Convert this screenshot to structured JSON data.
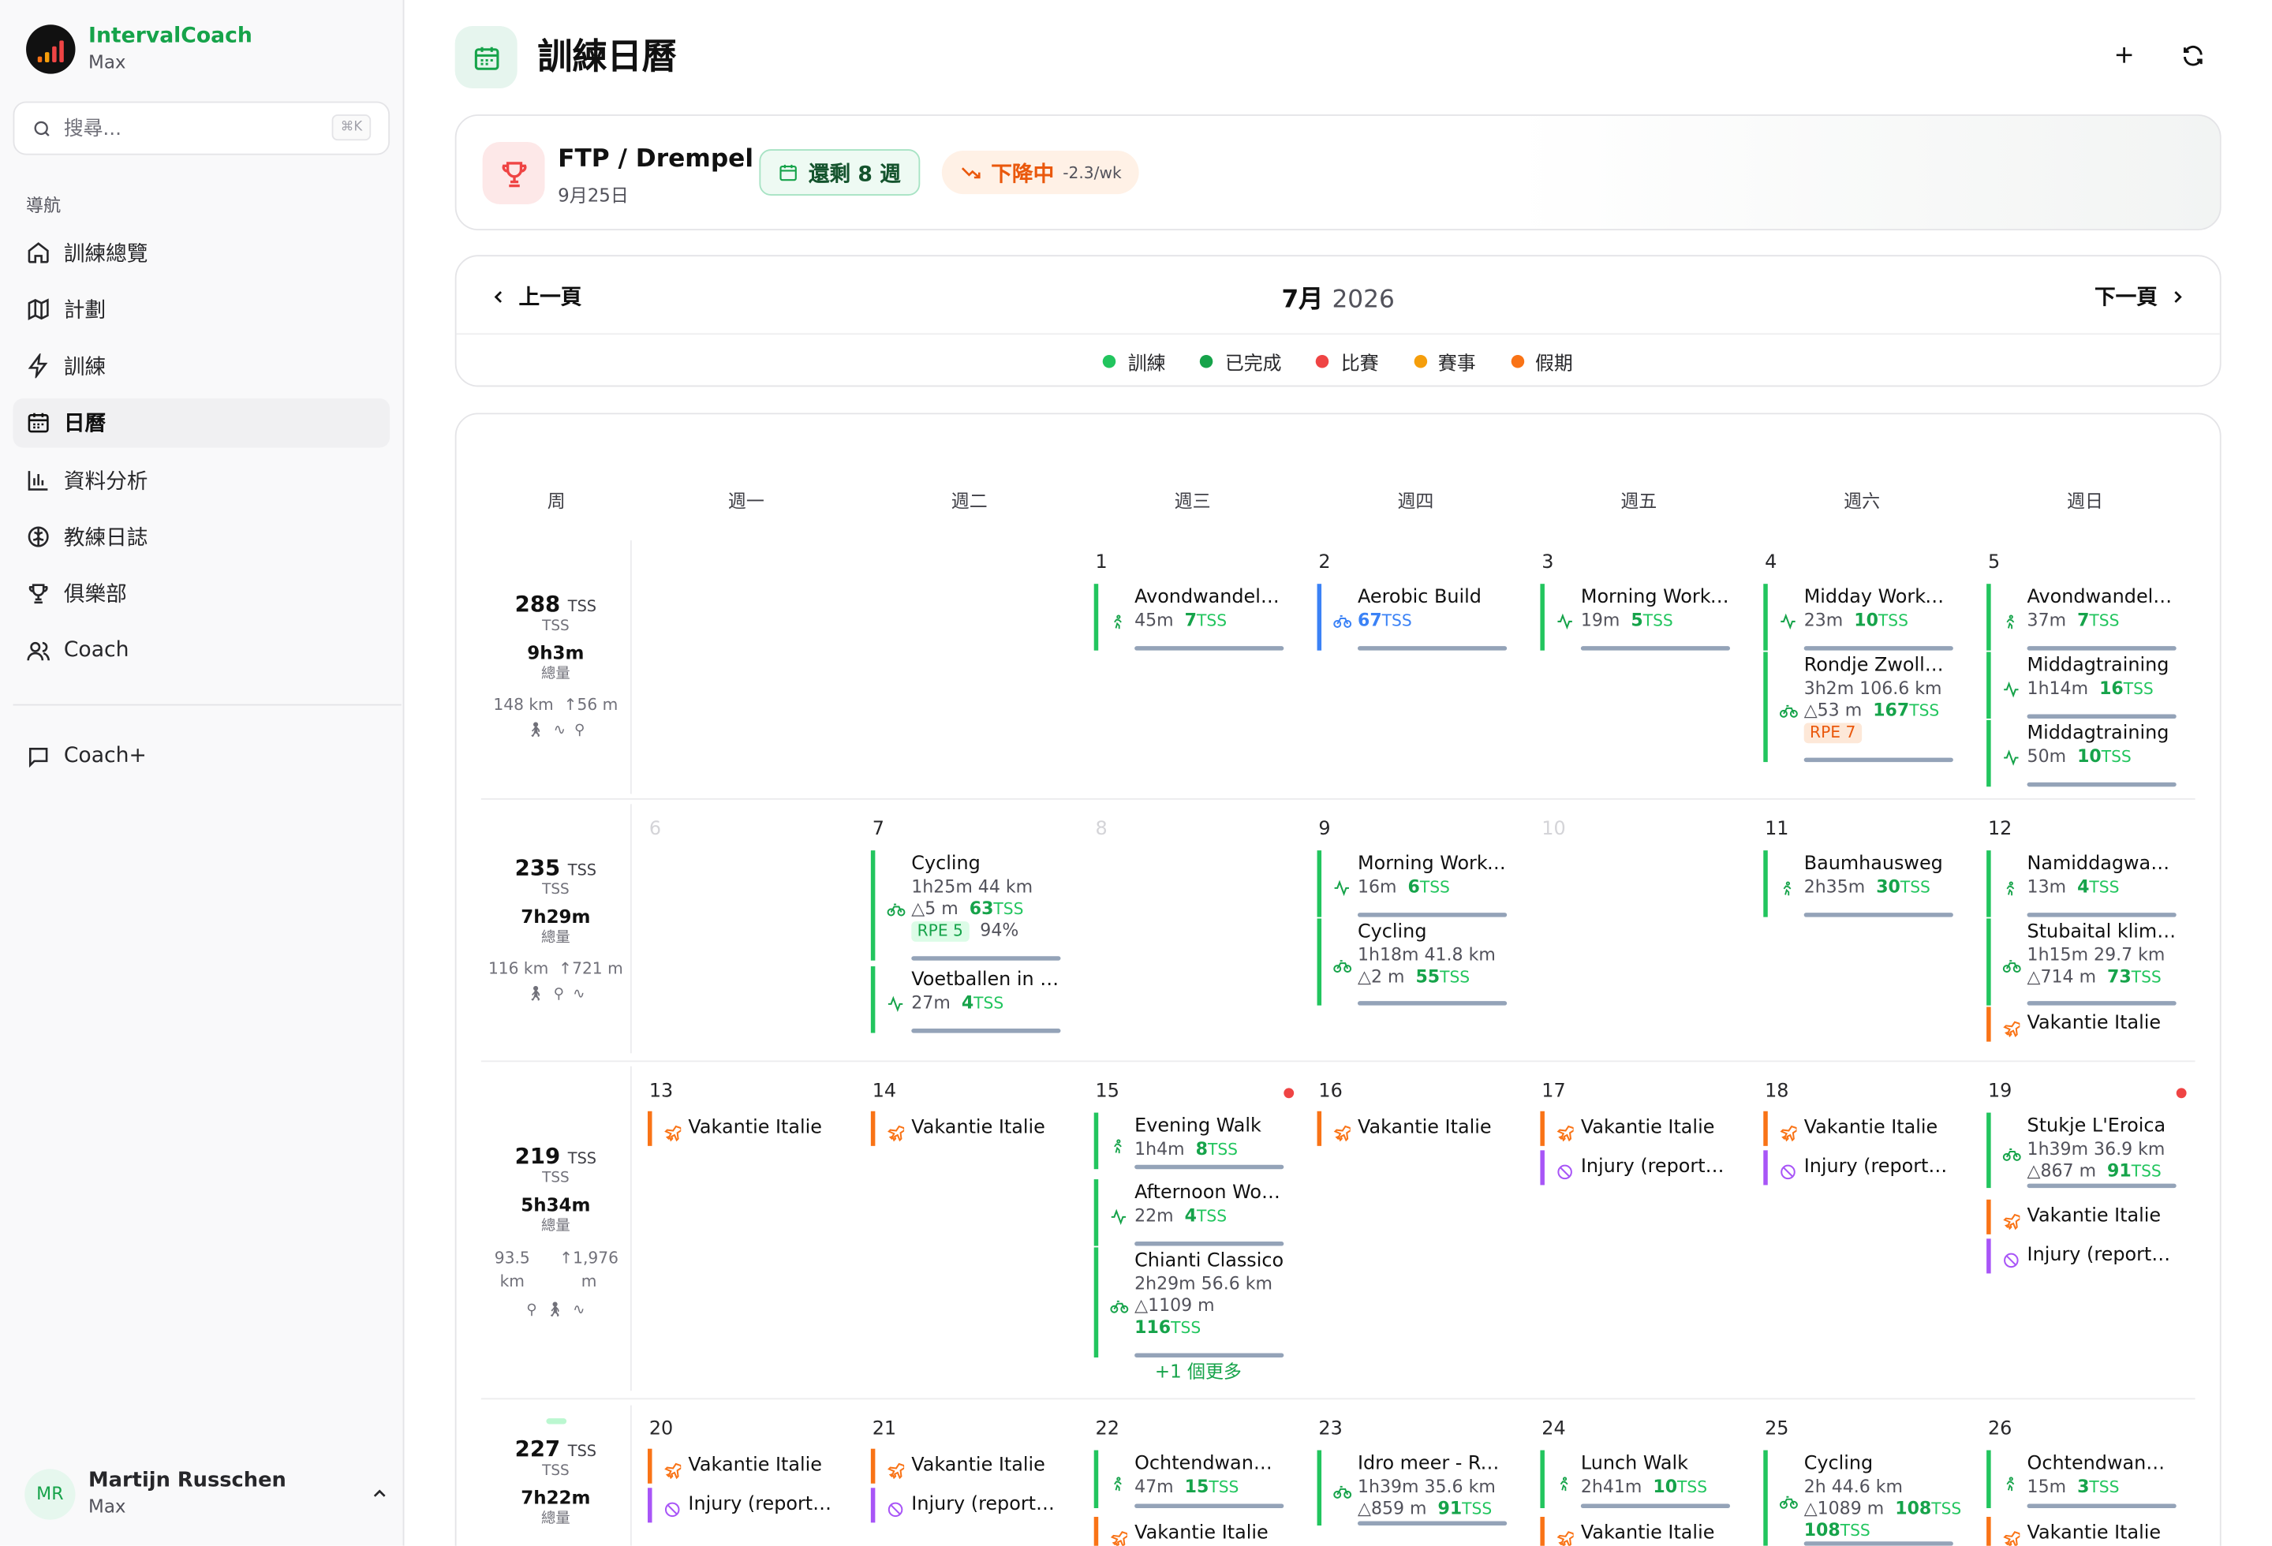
{
  "app": {
    "name": "IntervalCoach",
    "user": "Max"
  },
  "search": {
    "placeholder": "搜尋...",
    "shortcut": "⌘K"
  },
  "nav": {
    "heading": "導航",
    "items": [
      "訓練總覽",
      "計劃",
      "訓練",
      "日曆",
      "資料分析",
      "教練日誌",
      "俱樂部",
      "Coach"
    ],
    "extra": "Coach+"
  },
  "profile": {
    "initials": "MR",
    "name": "Martijn Russchen",
    "sub": "Max"
  },
  "page": {
    "title": "訓練日曆"
  },
  "goal": {
    "title": "FTP / Drempel",
    "date": "9月25日",
    "weeks": "還剩 8 週",
    "trend": "下降中",
    "rate": "-2.3/wk"
  },
  "calendar": {
    "prev": "上一頁",
    "next": "下一頁",
    "month": "7月",
    "year": "2026"
  },
  "legend": [
    {
      "label": "訓練",
      "color": "#22c55e"
    },
    {
      "label": "已完成",
      "color": "#16a34a"
    },
    {
      "label": "比賽",
      "color": "#ef4444"
    },
    {
      "label": "賽事",
      "color": "#f59e0b"
    },
    {
      "label": "假期",
      "color": "#f97316"
    }
  ],
  "days": [
    "周",
    "週一",
    "週二",
    "週三",
    "週四",
    "週五",
    "週六",
    "週日"
  ],
  "weeks": [
    {
      "tss": "288",
      "unit": "TSS",
      "lbl": "TSS",
      "dur": "9h3m",
      "durlbl": "總量",
      "dist": "148 km",
      "elev": "56 m"
    },
    {
      "tss": "235",
      "unit": "TSS",
      "lbl": "TSS",
      "dur": "7h29m",
      "durlbl": "總量",
      "dist": "116 km",
      "elev": "721 m"
    },
    {
      "tss": "219",
      "unit": "TSS",
      "lbl": "TSS",
      "dur": "5h34m",
      "durlbl": "總量",
      "dist": "93.5 km",
      "elev": "1,976 m"
    },
    {
      "tss": "227",
      "unit": "TSS",
      "lbl": "TSS",
      "dur": "7h22m",
      "durlbl": "總量"
    }
  ],
  "dates": [
    "1",
    "2",
    "3",
    "4",
    "5",
    "6",
    "7",
    "8",
    "9",
    "10",
    "11",
    "12",
    "13",
    "14",
    "15",
    "16",
    "17",
    "18",
    "19",
    "20",
    "21",
    "22",
    "23",
    "24",
    "25",
    "26"
  ],
  "acts": [
    {
      "t": "Avondwandeling",
      "s": "45m",
      "tss": "7"
    },
    {
      "t": "Aerobic Build",
      "tss": "67"
    },
    {
      "t": "Morning Workout",
      "s": "19m",
      "tss": "5"
    },
    {
      "t": "Midday Workout",
      "s": "23m",
      "tss": "10"
    },
    {
      "t": "Rondje Zwolle ...",
      "s": "3h2m 106.6 km",
      "e": "53 m",
      "tss": "167",
      "rpe": "RPE 7"
    },
    {
      "t": "Avondwandeling",
      "s": "37m",
      "tss": "7"
    },
    {
      "t": "Middagtraining",
      "s": "1h14m",
      "tss": "16"
    },
    {
      "t": "Middagtraining",
      "s": "50m",
      "tss": "10"
    },
    {
      "t": "Cycling",
      "s": "1h25m 44 km",
      "e": "5 m",
      "tss": "63",
      "rpe": "RPE 5",
      "pct": "94%"
    },
    {
      "t": "Voetballen in d...",
      "s": "27m",
      "tss": "4"
    },
    {
      "t": "Morning Workout",
      "s": "16m",
      "tss": "6"
    },
    {
      "t": "Cycling",
      "s": "1h18m 41.8 km",
      "e": "2 m",
      "tss": "55"
    },
    {
      "t": "Baumhausweg",
      "s": "2h35m",
      "tss": "30"
    },
    {
      "t": "Namiddagwandeling",
      "s": "13m",
      "tss": "4"
    },
    {
      "t": "Stubaital klim ...",
      "s": "1h15m 29.7 km",
      "e": "714 m",
      "tss": "73"
    },
    {
      "t": "Evening Walk",
      "s": "1h4m",
      "tss": "8"
    },
    {
      "t": "Afternoon Workout",
      "s": "22m",
      "tss": "4"
    },
    {
      "t": "Chianti Classico",
      "s": "2h29m 56.6 km",
      "e": "1109 m",
      "tss": "116"
    },
    {
      "t": "Stukje L'Eroica",
      "s": "1h39m 36.9 km",
      "e": "867 m",
      "tss": "91"
    },
    {
      "t": "Ochtendwandeling",
      "s": "47m",
      "tss": "15"
    },
    {
      "t": "Idro meer - Rovereto",
      "s": "1h39m 35.6 km",
      "e": "859 m",
      "tss": "91"
    },
    {
      "t": "Lunch Walk",
      "s": "2h41m",
      "tss": "10"
    },
    {
      "t": "Cycling",
      "s": "2h 44.6 km",
      "e": "1089 m",
      "tss": "108"
    },
    {
      "t": "Ochtendwandeling",
      "s": "15m",
      "tss": "3"
    }
  ],
  "tss_unit": "TSS",
  "event_vacation": "Vakantie Italie",
  "event_injury": "Injury (reported)",
  "more": "+1 個更多"
}
